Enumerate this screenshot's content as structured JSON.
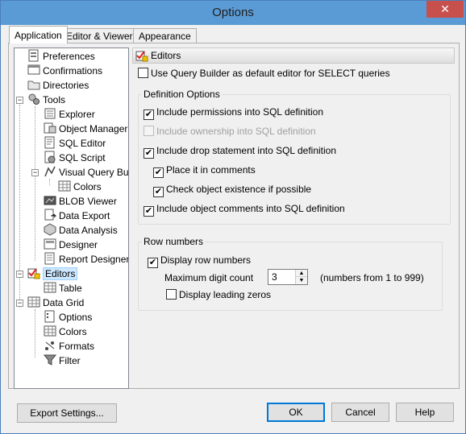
{
  "window": {
    "title": "Options",
    "close_symbol": "✕"
  },
  "tabs": [
    {
      "label": "Application",
      "active": true
    },
    {
      "label": "Editor & Viewers",
      "active": false
    },
    {
      "label": "Appearance",
      "active": false
    }
  ],
  "tree": [
    {
      "label": "Preferences",
      "icon": "preferences-icon"
    },
    {
      "label": "Confirmations",
      "icon": "confirmations-icon"
    },
    {
      "label": "Directories",
      "icon": "folder-icon"
    },
    {
      "label": "Tools",
      "icon": "tools-icon"
    },
    {
      "label": "Explorer",
      "icon": "explorer-icon"
    },
    {
      "label": "Object Manager",
      "icon": "object-manager-icon"
    },
    {
      "label": "SQL Editor",
      "icon": "sql-editor-icon"
    },
    {
      "label": "SQL Script",
      "icon": "sql-script-icon"
    },
    {
      "label": "Visual Query Builc",
      "icon": "visual-query-builder-icon"
    },
    {
      "label": "Colors",
      "icon": "grid-icon"
    },
    {
      "label": "BLOB Viewer",
      "icon": "blob-viewer-icon"
    },
    {
      "label": "Data Export",
      "icon": "data-export-icon"
    },
    {
      "label": "Data Analysis",
      "icon": "data-analysis-icon"
    },
    {
      "label": "Designer",
      "icon": "designer-icon"
    },
    {
      "label": "Report Designer",
      "icon": "report-designer-icon"
    },
    {
      "label": "Editors",
      "icon": "editors-icon",
      "selected": true
    },
    {
      "label": "Table",
      "icon": "grid-icon"
    },
    {
      "label": "Data Grid",
      "icon": "grid-icon"
    },
    {
      "label": "Options",
      "icon": "options-icon"
    },
    {
      "label": "Colors",
      "icon": "grid-icon"
    },
    {
      "label": "Formats",
      "icon": "formats-icon"
    },
    {
      "label": "Filter",
      "icon": "filter-icon"
    }
  ],
  "editors": {
    "header": "Editors",
    "default_editor_label": "Use Query Builder as default editor for SELECT queries",
    "default_editor_checked": false,
    "definition_options": {
      "title": "Definition Options",
      "permissions": {
        "label": "Include permissions into SQL definition",
        "checked": true
      },
      "ownership": {
        "label": "Include ownership into SQL definition",
        "checked": false
      },
      "drop": {
        "label": "Include drop statement into SQL definition",
        "checked": true
      },
      "comments_place": {
        "label": "Place it in comments",
        "checked": true
      },
      "existence": {
        "label": "Check object existence if possible",
        "checked": true
      },
      "object_comments": {
        "label": "Include object comments into SQL definition",
        "checked": true
      }
    },
    "row_numbers": {
      "title": "Row numbers",
      "display": {
        "label": "Display row numbers",
        "checked": true
      },
      "max_digit_label": "Maximum digit count",
      "max_digit_value": "3",
      "max_digit_hint": "(numbers from 1 to 999)",
      "leading_zeros": {
        "label": "Display leading zeros",
        "checked": false
      }
    }
  },
  "buttons": {
    "export": "Export Settings...",
    "ok": "OK",
    "cancel": "Cancel",
    "help": "Help"
  },
  "check_symbol": "✔"
}
